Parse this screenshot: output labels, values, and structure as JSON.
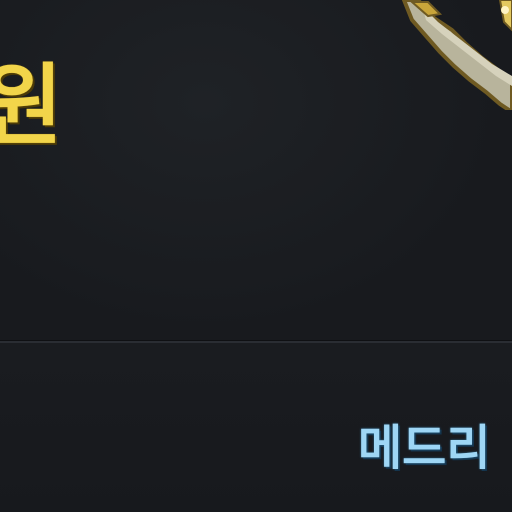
{
  "title": {
    "text": "원"
  },
  "player": {
    "name": "메드리"
  },
  "icons": {
    "corner_item": "sword-icon"
  },
  "colors": {
    "title": "#f2d54a",
    "name": "#9ed6f5",
    "background": "#17191d"
  }
}
